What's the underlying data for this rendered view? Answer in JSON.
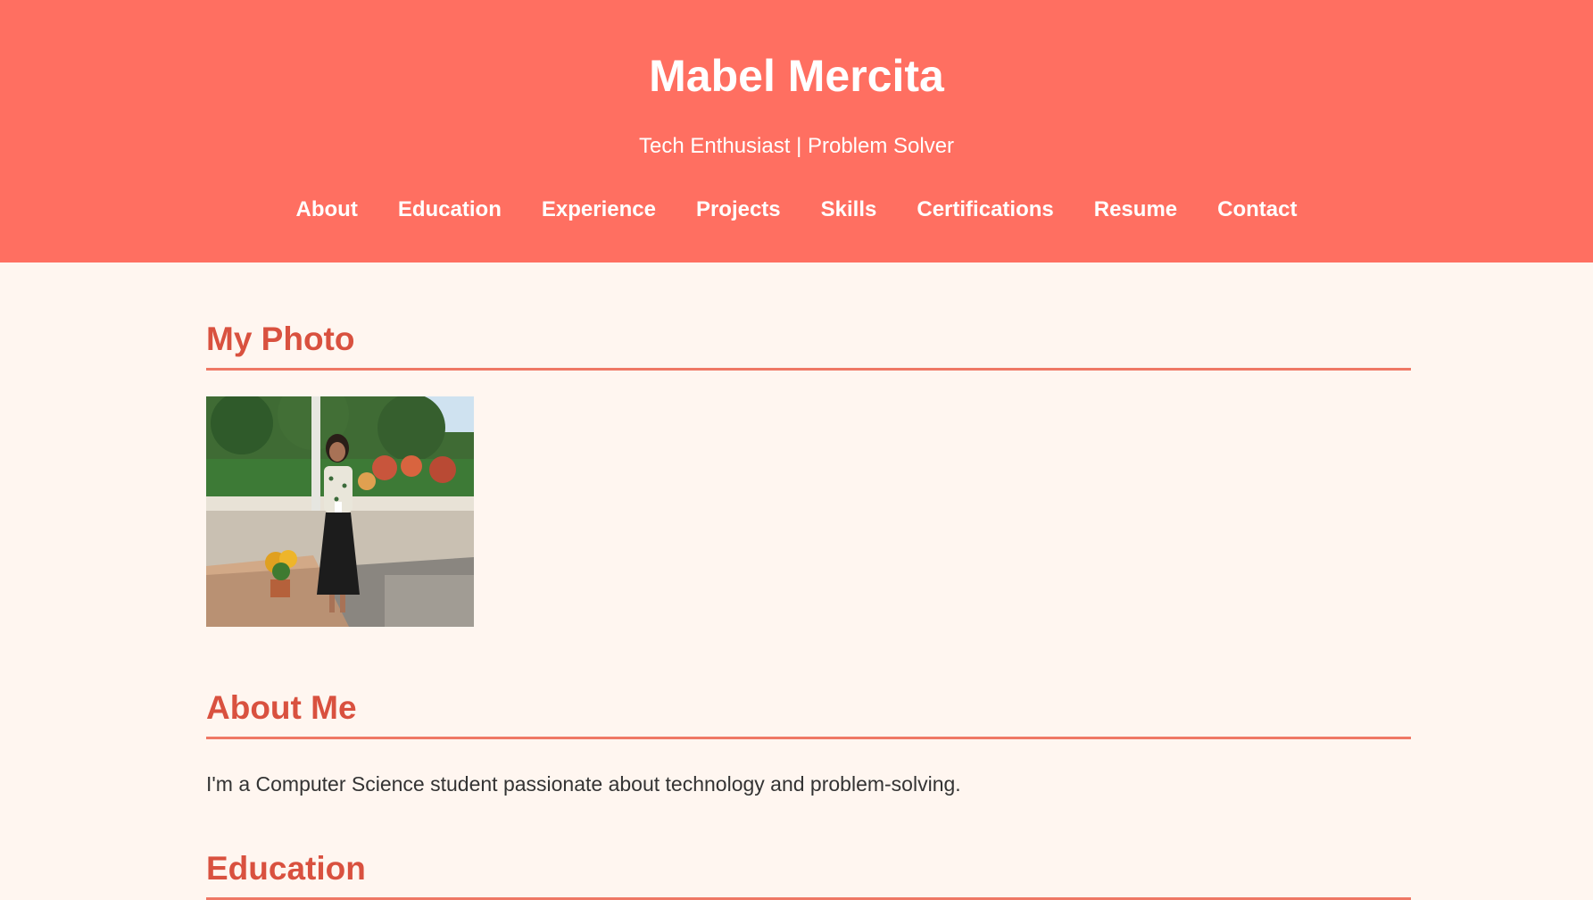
{
  "header": {
    "title": "Mabel Mercita",
    "tagline": "Tech Enthusiast | Problem Solver"
  },
  "nav": {
    "items": [
      "About",
      "Education",
      "Experience",
      "Projects",
      "Skills",
      "Certifications",
      "Resume",
      "Contact"
    ]
  },
  "sections": {
    "photo": {
      "title": "My Photo"
    },
    "about": {
      "title": "About Me",
      "text": "I'm a Computer Science student passionate about technology and problem-solving."
    },
    "education": {
      "title": "Education"
    }
  },
  "colors": {
    "header_bg": "#ff6f61",
    "page_bg": "#fff6f0",
    "section_title": "#d9513f",
    "divider": "#ef7865"
  }
}
